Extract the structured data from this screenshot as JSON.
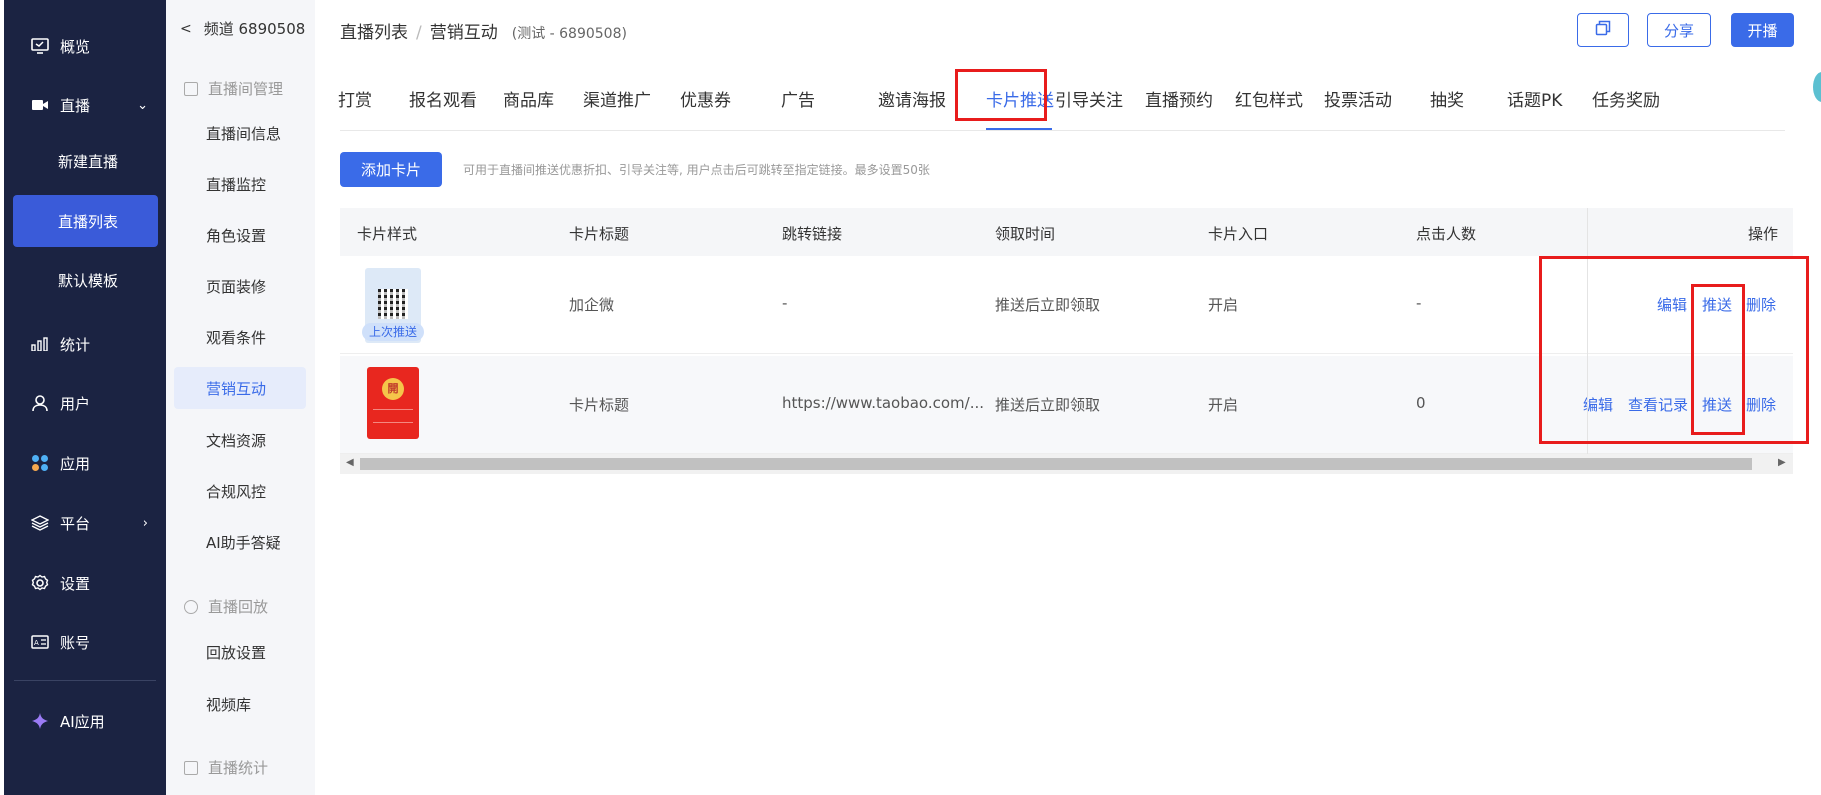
{
  "sidebar": {
    "items": [
      {
        "label": "概览",
        "icon": "monitor-icon"
      },
      {
        "label": "直播",
        "icon": "video-camera-icon"
      },
      {
        "label": "新建直播"
      },
      {
        "label": "直播列表"
      },
      {
        "label": "默认模板"
      },
      {
        "label": "统计",
        "icon": "bar-chart-icon"
      },
      {
        "label": "用户",
        "icon": "user-icon"
      },
      {
        "label": "应用",
        "icon": "apps-icon"
      },
      {
        "label": "平台",
        "icon": "layers-icon"
      },
      {
        "label": "设置",
        "icon": "gear-icon"
      },
      {
        "label": "账号",
        "icon": "id-card-icon"
      },
      {
        "label": "AI应用",
        "icon": "sparkle-icon"
      }
    ]
  },
  "submenu": {
    "back_label": "频道 6890508",
    "group1": "直播间管理",
    "items1": [
      "直播间信息",
      "直播监控",
      "角色设置",
      "页面装修",
      "观看条件",
      "营销互动",
      "文档资源",
      "合规风控",
      "AI助手答疑"
    ],
    "group2": "直播回放",
    "items2": [
      "回放设置",
      "视频库"
    ],
    "group3": "直播统计"
  },
  "header": {
    "crumb1": "直播列表",
    "crumb_sep": "/",
    "crumb2": "营销互动",
    "crumb_sub": "(测试 - 6890508)",
    "share_label": "分享",
    "start_label": "开播"
  },
  "tabs": [
    "打赏",
    "报名观看",
    "商品库",
    "渠道推广",
    "优惠券",
    "广告",
    "邀请海报",
    "卡片推送",
    "引导关注",
    "直播预约",
    "红包样式",
    "投票活动",
    "抽奖",
    "话题PK",
    "任务奖励"
  ],
  "toolbar": {
    "add_label": "添加卡片",
    "hint": "可用于直播间推送优惠折扣、引导关注等, 用户点击后可跳转至指定链接。最多设置50张"
  },
  "table": {
    "headers": [
      "卡片样式",
      "卡片标题",
      "跳转链接",
      "领取时间",
      "卡片入口",
      "点击人数",
      "操作"
    ],
    "rows": [
      {
        "tag": "上次推送",
        "title": "加企微",
        "link": "-",
        "time": "推送后立即领取",
        "entry": "开启",
        "clicks": "-",
        "ops": [
          "编辑",
          "推送",
          "删除"
        ]
      },
      {
        "title": "卡片标题",
        "link": "https://www.taobao.com/...",
        "time": "推送后立即领取",
        "entry": "开启",
        "clicks": "0",
        "ops": [
          "编辑",
          "查看记录",
          "推送",
          "删除"
        ]
      }
    ]
  },
  "colors": {
    "accent": "#3a6be8",
    "sidebar": "#1b2342",
    "highlight": "#e81c1c"
  }
}
